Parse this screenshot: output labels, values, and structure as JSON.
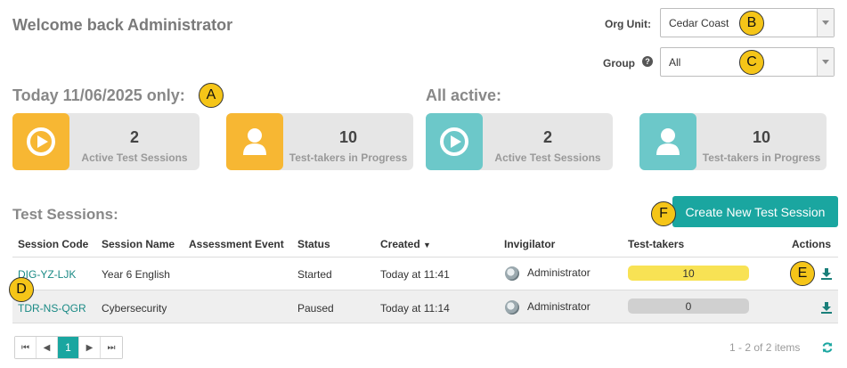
{
  "welcome": "Welcome back Administrator",
  "filters": {
    "org_unit_label": "Org Unit:",
    "org_unit_value": "Cedar Coast",
    "group_label": "Group",
    "group_help": "?",
    "group_value": "All"
  },
  "today": {
    "title": "Today 11/06/2025 only:",
    "active_sessions": {
      "value": "2",
      "label": "Active Test Sessions"
    },
    "test_takers": {
      "value": "10",
      "label": "Test-takers in Progress"
    }
  },
  "all_active": {
    "title": "All active:",
    "active_sessions": {
      "value": "2",
      "label": "Active Test Sessions"
    },
    "test_takers": {
      "value": "10",
      "label": "Test-takers in Progress"
    }
  },
  "markers": {
    "a": "A",
    "b": "B",
    "c": "C",
    "d": "D",
    "e": "E",
    "f": "F"
  },
  "sessions_title": "Test Sessions:",
  "create_button": "Create New Test Session",
  "table": {
    "headers": {
      "code": "Session Code",
      "name": "Session Name",
      "event": "Assessment Event",
      "status": "Status",
      "created": "Created",
      "created_sort": "▼",
      "invigilator": "Invigilator",
      "takers": "Test-takers",
      "actions": "Actions"
    },
    "rows": [
      {
        "code": "DIG-YZ-LJK",
        "name": "Year 6 English",
        "event": "",
        "status": "Started",
        "created": "Today at 11:41",
        "invigilator": "Administrator",
        "takers": "10"
      },
      {
        "code": "TDR-NS-QGR",
        "name": "Cybersecurity",
        "event": "",
        "status": "Paused",
        "created": "Today at 11:14",
        "invigilator": "Administrator",
        "takers": "0"
      }
    ]
  },
  "pager": {
    "first": "⏮",
    "prev": "◀",
    "page": "1",
    "next": "▶",
    "last": "⏭"
  },
  "items_info": "1 - 2 of 2 items",
  "colors": {
    "orange": "#f7b733",
    "teal": "#6cc8c9",
    "button": "#1aa6a0",
    "bar_active": "#f8e254",
    "bar_idle": "#d0d0d0"
  }
}
